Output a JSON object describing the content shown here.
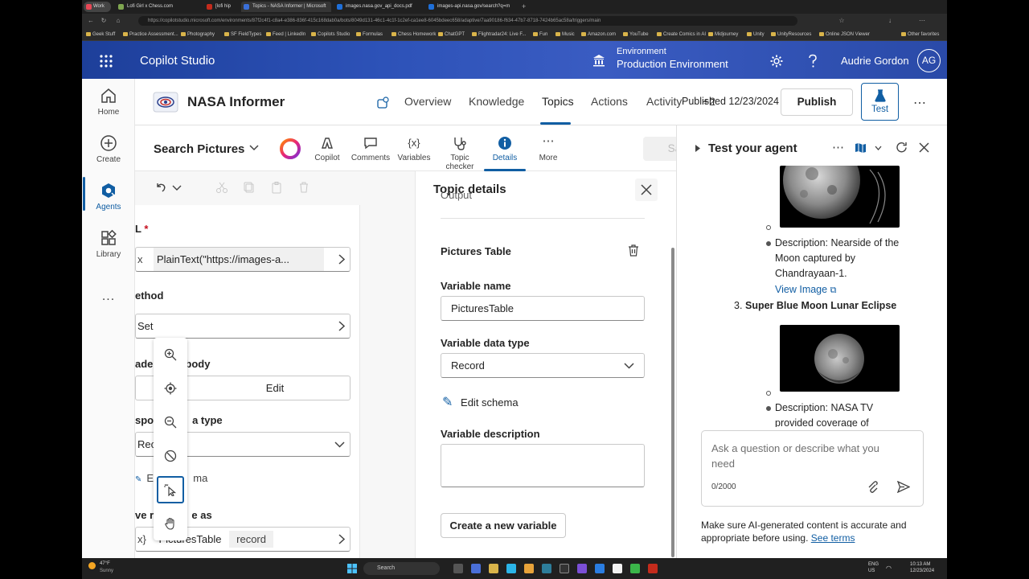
{
  "browser": {
    "tabs": [
      {
        "label": "Work",
        "color": "#e74856"
      },
      {
        "label": "Lofi Girl x Chess.com",
        "color": "#7fa650"
      },
      {
        "label": "[lofi hip",
        "color": "#c42b1c"
      },
      {
        "label": "Topics - NASA Informer | Microsoft",
        "color": "#3a6fd8"
      },
      {
        "label": "images.nasa.gov_api_docs.pdf",
        "color": "#1e6fd9"
      },
      {
        "label": "images-api.nasa.gov/search?q=m",
        "color": "#1e6fd9"
      }
    ],
    "url": "https://copilotstudio.microsoft.com/environments/87f2c4f1-c8a4-e386-836f-415c168dab0a/bots/8049d131-46c1-4c1f-1c2ef-ca1ee8-6045bdeec658/adaptive/7aa90186-f634-47b7-8718-7424b65ac58a/triggers/main",
    "bookmarks": [
      "Geek Stuff",
      "Practice Assessment...",
      "Photography",
      "SF FieldTypes",
      "Feed | LinkedIn",
      "Copilots Studio",
      "Formulas",
      "Chess Homework",
      "ChatGPT",
      "Flightradar24: Live F...",
      "Fun",
      "Music",
      "Amazon.com",
      "YouTube",
      "Create Comics in AI",
      "Midjourney",
      "Unity",
      "UnityResources",
      "Online JSON Viewer"
    ],
    "other_favorites": "Other favorites"
  },
  "app": {
    "title": "Copilot Studio",
    "environment_label": "Environment",
    "environment_name": "Production Environment",
    "user_name": "Audrie Gordon",
    "user_initials": "AG",
    "header_color": "#2d52b8"
  },
  "rail": [
    {
      "label": "Home",
      "icon": "home-icon"
    },
    {
      "label": "Create",
      "icon": "plus-circle-icon"
    },
    {
      "label": "Agents",
      "icon": "agents-icon",
      "selected": true
    },
    {
      "label": "Library",
      "icon": "library-icon"
    },
    {
      "label": "...",
      "icon": "more-icon"
    }
  ],
  "agent": {
    "name": "NASA Informer",
    "nav": [
      "Overview",
      "Knowledge",
      "Topics",
      "Actions",
      "Activity",
      "+2"
    ],
    "active_nav": "Topics",
    "published": "Published 12/23/2024",
    "publish_label": "Publish",
    "test_label": "Test",
    "accent": "#115ea3"
  },
  "toolbar": {
    "topic_name": "Search Pictures",
    "buttons": [
      "Copilot",
      "Comments",
      "Variables",
      "Topic checker",
      "Details",
      "More"
    ],
    "active_button": "Details",
    "save_label": "Save"
  },
  "canvas": {
    "url_label": "L",
    "url_required": "*",
    "url_formula_prefix": "x",
    "url_value": "PlainText(\"https://images-a...",
    "method_label": "ethod",
    "method_value": "Set",
    "headers_label_a": "ade",
    "headers_label_b": "body",
    "edit_label": "Edit",
    "response_label_a": "spon",
    "response_label_b": "a type",
    "response_value": "Reco",
    "edit_schema_a": "Ed",
    "edit_schema_b": "ma",
    "save_as_label_a": "ve re",
    "save_as_label_b": "e as",
    "var_prefix": "x}",
    "var_name": "PicturesTable",
    "var_type": "record"
  },
  "details": {
    "title": "Topic details",
    "partial_label": "Output",
    "section": "Pictures Table",
    "var_name_label": "Variable name",
    "var_name_value": "PicturesTable",
    "data_type_label": "Variable data type",
    "data_type_value": "Record",
    "edit_schema": "Edit schema",
    "desc_label": "Variable description",
    "desc_value": "",
    "create_label": "Create a new variable"
  },
  "test": {
    "title": "Test your agent",
    "desc1": "Description: Nearside of the Moon captured by Chandrayaan-1.",
    "view_image": "View Image",
    "item_number": "3.",
    "item_title": "Super Blue Moon Lunar Eclipse",
    "desc2": "Description: NASA TV provided coverage of",
    "chat_placeholder": "Ask a question or describe what you need",
    "chat_count": "0/2000",
    "disclaimer": "Make sure AI-generated content is accurate and appropriate before using.",
    "see_terms": "See terms"
  },
  "taskbar": {
    "weather_temp": "47°F",
    "weather_desc": "Sunny",
    "search_label": "Search",
    "lang": "ENG",
    "region": "US",
    "time": "10:13 AM",
    "date": "12/23/2024"
  }
}
